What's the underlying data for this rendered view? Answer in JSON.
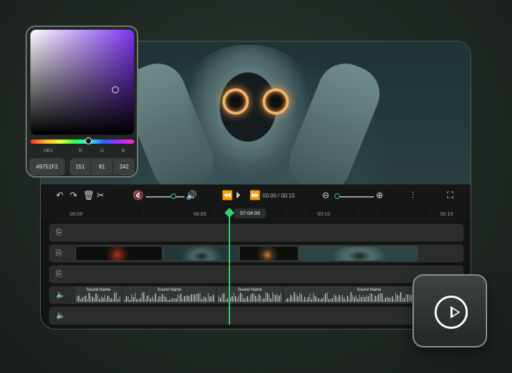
{
  "color_picker": {
    "hex_label": "HEX",
    "r_label": "R",
    "g_label": "G",
    "b_label": "B",
    "hex_value": "#9751F2",
    "r_value": "151",
    "g_value": "81",
    "b_value": "242",
    "color": "#9751F2"
  },
  "toolbar": {
    "time_display": "00:00 / 00:15",
    "volume_level": 0.75
  },
  "ruler": {
    "ticks": [
      "00:00",
      "00:05",
      "00:10",
      "00:15"
    ],
    "playhead_time": "07:04:00"
  },
  "tracks": {
    "audio_clips": [
      "Sound Name",
      "Sound Name",
      "Sound Name",
      "Sound Name"
    ]
  },
  "colors": {
    "accent": "#2FD36A"
  },
  "icons": [
    "undo-icon",
    "redo-icon",
    "trash-icon",
    "scissors-icon",
    "mute-icon",
    "volume-icon",
    "rewind-icon",
    "play-icon",
    "forward-icon",
    "zoom-out-icon",
    "zoom-in-icon",
    "split-icon",
    "fullscreen-icon",
    "video-track-icon",
    "audio-track-icon"
  ]
}
